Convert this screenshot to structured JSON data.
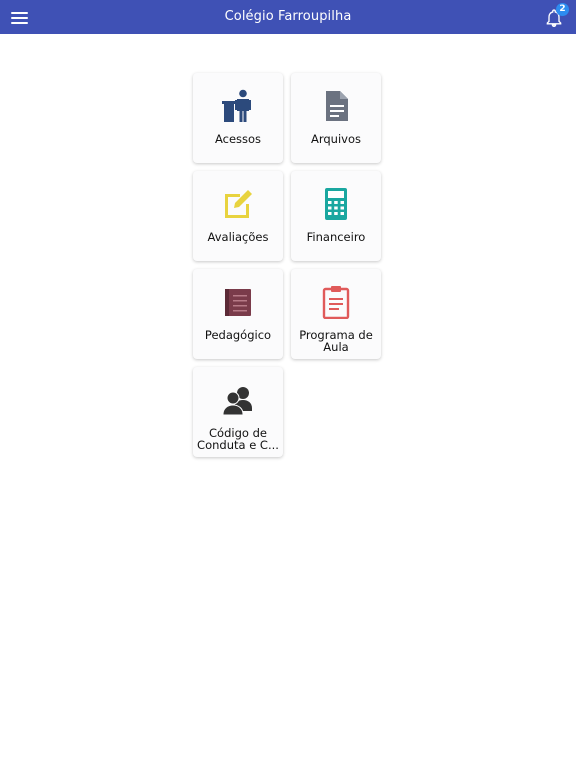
{
  "header": {
    "title": "Colégio Farroupilha",
    "notification_count": "2"
  },
  "tiles": [
    {
      "label": "Acessos",
      "icon": "person-turnstile-icon",
      "color": "#2c4a7c"
    },
    {
      "label": "Arquivos",
      "icon": "document-icon",
      "color": "#6b7280"
    },
    {
      "label": "Avaliações",
      "icon": "edit-icon",
      "color": "#e8d33f"
    },
    {
      "label": "Financeiro",
      "icon": "calculator-icon",
      "color": "#1aa7a0"
    },
    {
      "label": "Pedagógico",
      "icon": "book-icon",
      "color": "#7a3b4a"
    },
    {
      "label": "Programa de Aula",
      "icon": "clipboard-icon",
      "color": "#e05a5a"
    },
    {
      "label": "Código de Conduta e C...",
      "icon": "people-icon",
      "color": "#333333"
    }
  ],
  "colors": {
    "header_bg": "#3f51b5",
    "badge_bg": "#2d8cf0"
  }
}
